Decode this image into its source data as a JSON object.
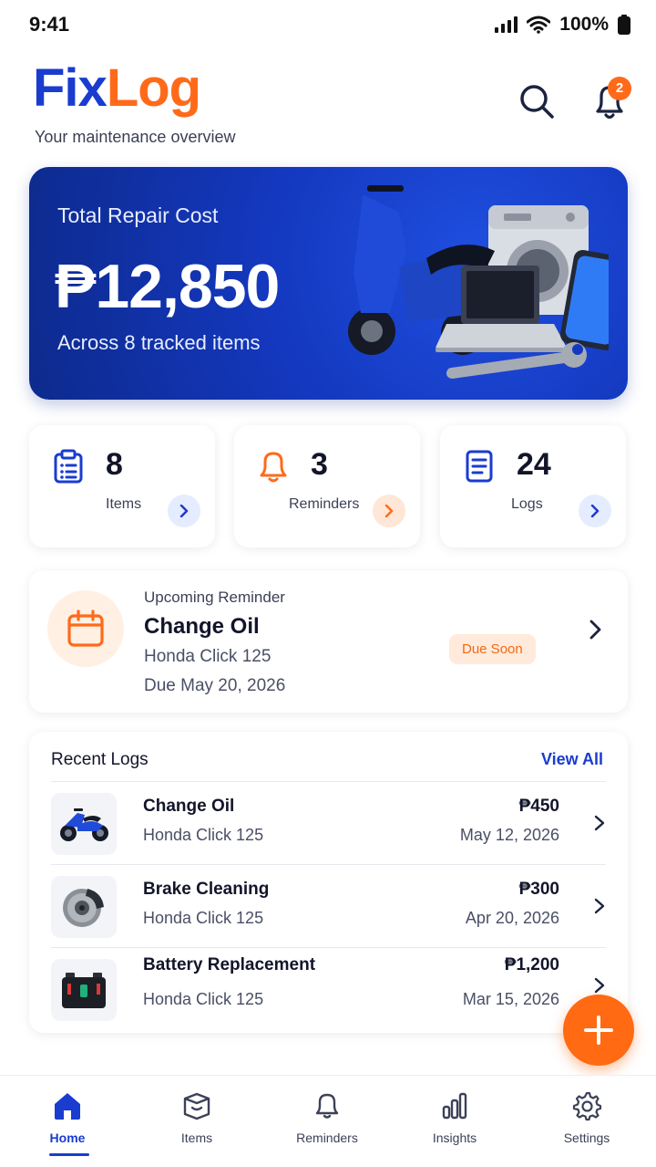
{
  "status_bar": {
    "time": "9:41",
    "battery": "100%"
  },
  "header": {
    "brand_part1": "Fix",
    "brand_part2": "Log",
    "subtitle": "Your maintenance overview",
    "notification_count": "2",
    "icons": [
      "search-icon",
      "bell-icon"
    ]
  },
  "hero": {
    "label": "Total Repair Cost",
    "value": "₱12,850",
    "sublabel": "Across 8 tracked items"
  },
  "stats": [
    {
      "value": "8",
      "label": "Items",
      "icon": "clipboard-icon",
      "accent": "#1a3ccf"
    },
    {
      "value": "3",
      "label": "Reminders",
      "icon": "bell-icon",
      "accent": "#ff6a1a"
    },
    {
      "value": "24",
      "label": "Logs",
      "icon": "document-icon",
      "accent": "#1a3ccf"
    }
  ],
  "reminder": {
    "caption": "Upcoming Reminder",
    "title": "Change Oil",
    "vehicle": "Honda Click 125",
    "due": "Due May 20, 2026",
    "status": "Due Soon"
  },
  "recent_logs": {
    "title": "Recent Logs",
    "view_all": "View All",
    "items": [
      {
        "name": "Change Oil",
        "vehicle": "Honda Click 125",
        "amount": "₱450",
        "date": "May 12, 2026",
        "thumb": "motorcycle-icon"
      },
      {
        "name": "Brake Cleaning",
        "vehicle": "Honda Click 125",
        "amount": "₱300",
        "date": "Apr 20, 2026",
        "thumb": "brake-disc-icon"
      },
      {
        "name": "Battery Replacement",
        "vehicle": "Honda Click 125",
        "amount": "₱1,200",
        "date": "Mar 15, 2026",
        "thumb": "battery-icon"
      }
    ]
  },
  "bottom_nav": [
    {
      "label": "Home",
      "icon": "home-icon",
      "active": true
    },
    {
      "label": "Items",
      "icon": "box-icon",
      "active": false
    },
    {
      "label": "Reminders",
      "icon": "bell-icon",
      "active": false
    },
    {
      "label": "Insights",
      "icon": "bar-chart-icon",
      "active": false
    },
    {
      "label": "Settings",
      "icon": "gear-icon",
      "active": false
    }
  ],
  "colors": {
    "primary": "#1a3ccf",
    "accent": "#ff6a1a"
  }
}
